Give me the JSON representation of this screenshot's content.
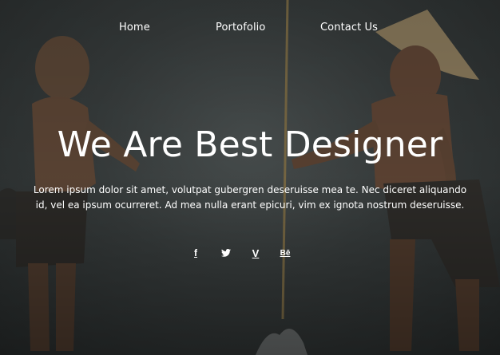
{
  "nav": {
    "items": [
      {
        "label": "Home"
      },
      {
        "label": "Portofolio"
      },
      {
        "label": "Contact Us"
      }
    ]
  },
  "hero": {
    "title": "We Are Best Designer",
    "description": "Lorem ipsum dolor sit amet, volutpat gubergren deseruisse mea te. Nec diceret aliquando id, vel ea ipsum ocurreret. Ad mea nulla erant epicuri, vim ex ignota nostrum deseruisse."
  },
  "social": {
    "icons": [
      "facebook-icon",
      "twitter-icon",
      "vimeo-icon",
      "behance-icon"
    ],
    "facebook_glyph": "f",
    "vimeo_glyph": "V",
    "behance_glyph": "Bē"
  },
  "colors": {
    "text": "#ffffff",
    "background": "#2f3434"
  }
}
